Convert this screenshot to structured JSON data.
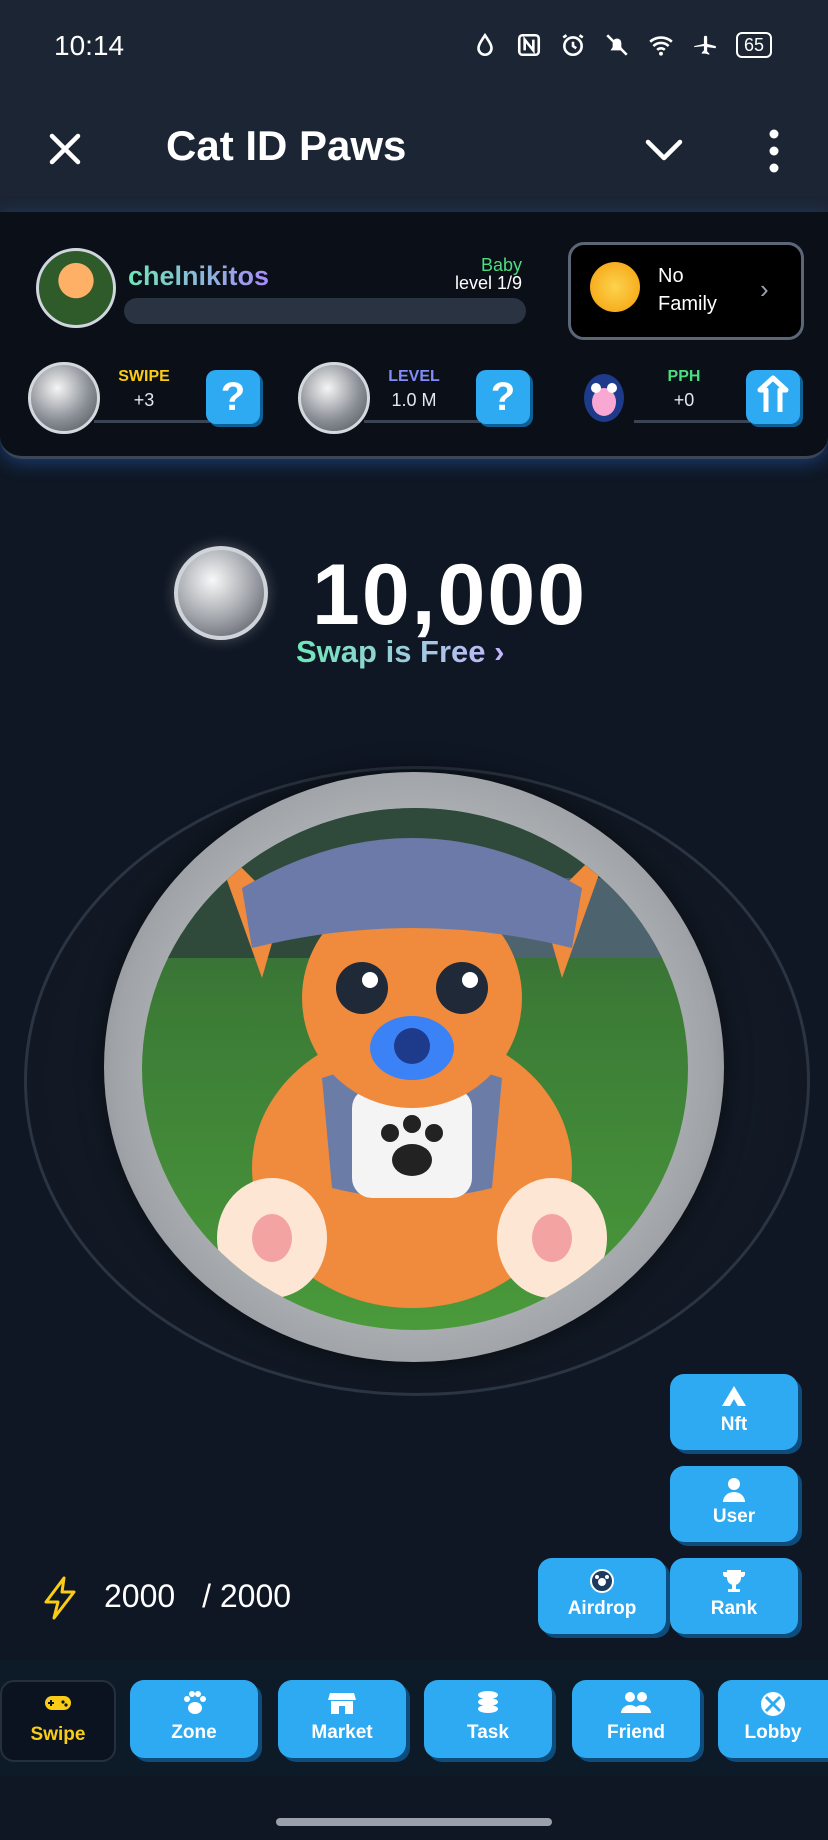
{
  "status_bar": {
    "time": "10:14",
    "battery": "65"
  },
  "app_bar": {
    "title": "Cat ID Paws"
  },
  "profile": {
    "username": "chelnikitos",
    "level_name": "Baby",
    "level_text": "level 1/9",
    "progress": 0
  },
  "family": {
    "line1": "No",
    "line2": "Family"
  },
  "stats": [
    {
      "label": "SWIPE",
      "value": "+3",
      "label_color": "#facc15"
    },
    {
      "label": "LEVEL",
      "value": "1.0 M",
      "label_color": "#818cf8"
    },
    {
      "label": "PPH",
      "value": "+0",
      "label_color": "#4ade80"
    }
  ],
  "balance": {
    "amount": "10,000",
    "swap_link": "Swap is Free ›"
  },
  "side_buttons": {
    "nft": "Nft",
    "user": "User",
    "airdrop": "Airdrop",
    "rank": "Rank"
  },
  "energy": {
    "current": "2000",
    "max": "/ 2000"
  },
  "nav": [
    {
      "label": "Swipe",
      "active": true
    },
    {
      "label": "Zone"
    },
    {
      "label": "Market"
    },
    {
      "label": "Task"
    },
    {
      "label": "Friend"
    },
    {
      "label": "Lobby"
    }
  ]
}
